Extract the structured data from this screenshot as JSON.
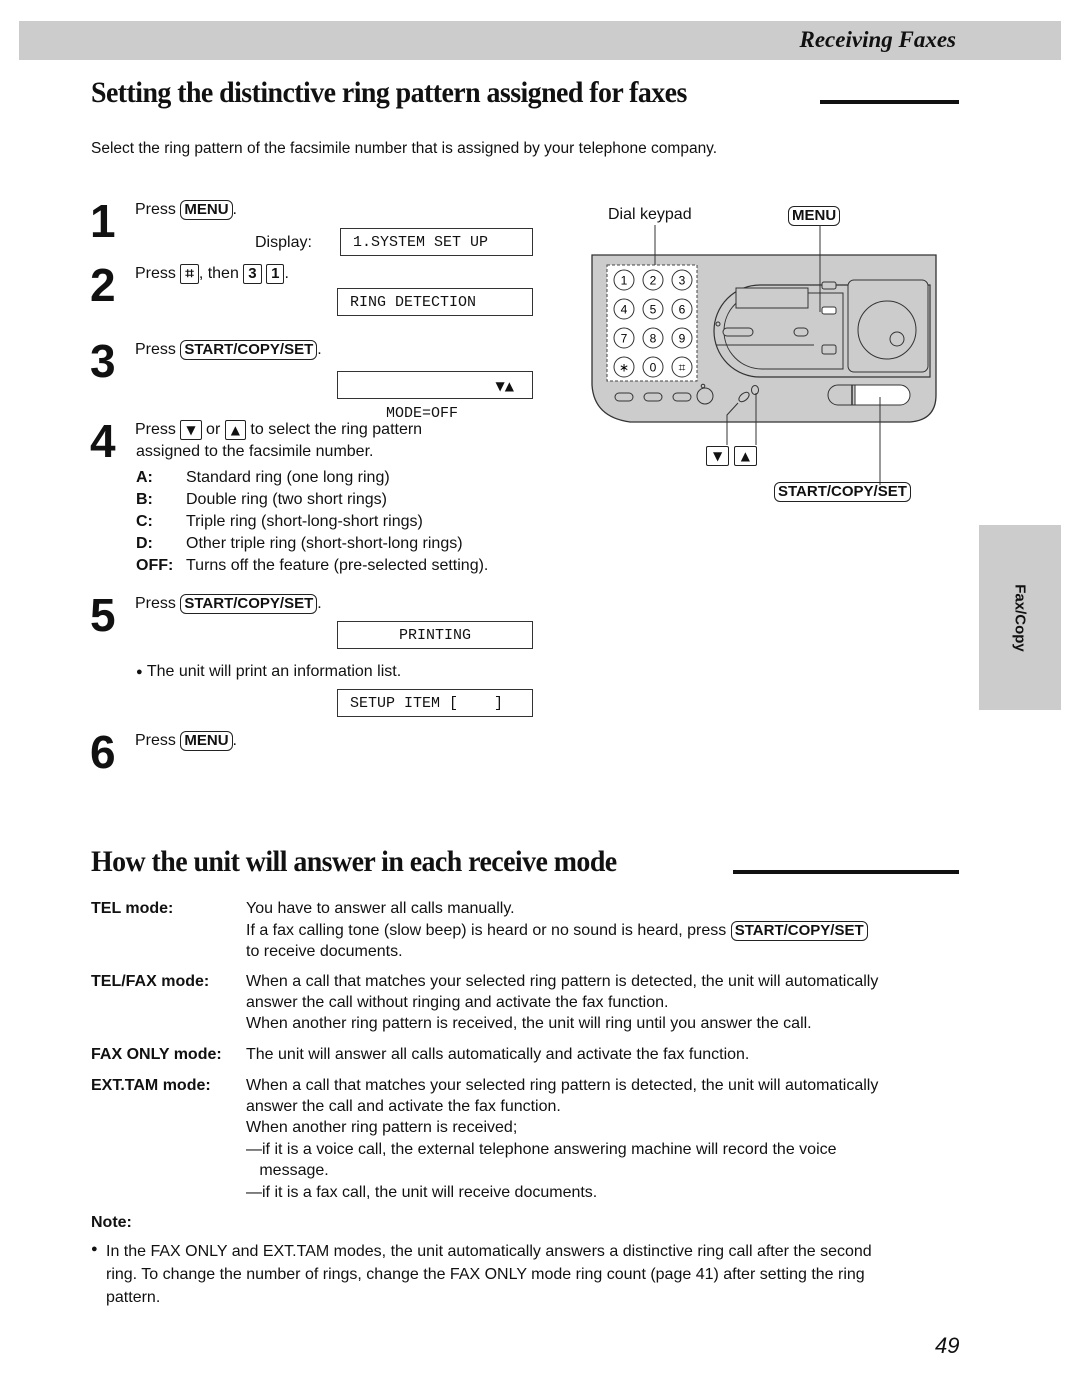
{
  "header": {
    "section_title": "Receiving Faxes"
  },
  "section1": {
    "title": "Setting the distinctive ring pattern assigned for faxes",
    "intro": "Select the ring pattern of the facsimile number that is assigned by your telephone company.",
    "steps": [
      {
        "number": "1",
        "press": "Press",
        "key": "MENU",
        "after": ".",
        "display_label": "Display:",
        "display": "1.SYSTEM SET UP"
      },
      {
        "number": "2",
        "press": "Press",
        "key": "⌗",
        "then": ", then",
        "key2": "3",
        "key3": "1",
        "after": ".",
        "display": "RING DETECTION"
      },
      {
        "number": "3",
        "press": "Press",
        "key": "START/COPY/SET",
        "after": ".",
        "display": "MODE=OFF",
        "display_arrows": "▼▲"
      },
      {
        "number": "4",
        "press": "Press",
        "key_down": "▼",
        "or": "or",
        "key_up": "▲",
        "line1_rest": "to select the ring pattern",
        "line2": "assigned to the facsimile number.",
        "options": [
          {
            "label": "A:",
            "text": "Standard ring (one long ring)"
          },
          {
            "label": "B:",
            "text": "Double ring (two short rings)"
          },
          {
            "label": "C:",
            "text": "Triple ring (short-long-short rings)"
          },
          {
            "label": "D:",
            "text": "Other triple ring (short-short-long rings)"
          },
          {
            "label": "OFF:",
            "text": "Turns off the feature (pre-selected setting)."
          }
        ]
      },
      {
        "number": "5",
        "press": "Press",
        "key": "START/COPY/SET",
        "after": ".",
        "display": "PRINTING",
        "bullet": "The unit will print an information list.",
        "display2": "SETUP ITEM [    ]"
      },
      {
        "number": "6",
        "press": "Press",
        "key": "MENU",
        "after": "."
      }
    ]
  },
  "diagram": {
    "dial_keypad_label": "Dial keypad",
    "menu_label": "MENU",
    "start_label": "START/COPY/SET",
    "down_key": "▼",
    "up_key": "▲",
    "keypad_keys": [
      "1",
      "2",
      "3",
      "4",
      "5",
      "6",
      "7",
      "8",
      "9",
      "∗",
      "0",
      "⌗"
    ]
  },
  "side_tab": {
    "label": "Fax/Copy"
  },
  "section2": {
    "title": "How the unit will answer in each receive mode",
    "modes": [
      {
        "label": "TEL mode:",
        "lines": [
          "You have to answer all calls manually."
        ],
        "line2_pre": "If a fax calling tone (slow beep) is heard or no sound is heard, press",
        "line2_key": "START/COPY/SET",
        "line3": "to receive documents."
      },
      {
        "label": "TEL/FAX mode:",
        "lines": [
          "When a call that matches your selected ring pattern is detected, the unit will automatically",
          "answer the call without ringing and activate the fax function.",
          "When another ring pattern is received, the unit will ring until you answer the call."
        ]
      },
      {
        "label": "FAX ONLY mode:",
        "lines": [
          "The unit will answer all calls automatically and activate the fax function."
        ]
      },
      {
        "label": "EXT.TAM mode:",
        "lines": [
          "When a call that matches your selected ring pattern is detected, the unit will automatically",
          "answer the call and activate the fax function.",
          "When another ring pattern is received;",
          "—if it is a voice call, the external telephone answering machine will record the voice",
          "   message.",
          "—if it is a fax call, the unit will receive documents."
        ]
      }
    ]
  },
  "note": {
    "label": "Note:",
    "lines": [
      "In the FAX ONLY and EXT.TAM modes, the unit automatically answers a distinctive ring call after the second",
      "ring. To change the number of rings, change the FAX ONLY mode ring count (page 41) after setting the ring",
      "pattern."
    ]
  },
  "footer": {
    "page_number": "49"
  }
}
